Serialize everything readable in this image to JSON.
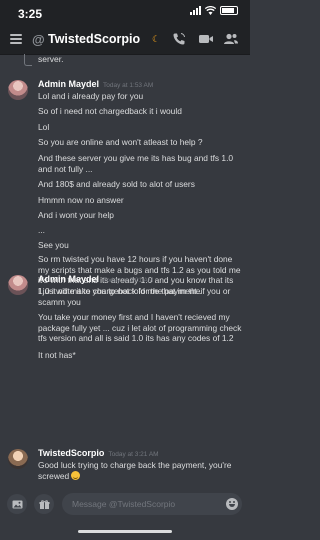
{
  "status": {
    "time": "3:25"
  },
  "header": {
    "at": "@",
    "channel": "TwistedScorpio",
    "moon": "☾"
  },
  "prev": {
    "text": "server."
  },
  "messages": [
    {
      "author": "Admin Maydel",
      "timestamp": "Today at 1:53 AM",
      "lines": [
        "Lol and i already pay for you",
        "So of i need not chargedback it i would",
        "Lol",
        "So you are online and won't atleast to help ?",
        "And these server you give me its has bug and tfs 1.0 and not fully ...",
        "And 180$ and already sold to alot of users",
        "Hmmm now no answer",
        "And i wont your help",
        "...",
        "See you",
        "So rm twisted you have 12 hours if you haven't done my scripts that make a bugs and tfs 1.2 as you told me it's with that and its already 1.0 and you know that its 1.0 i will make chargeback for the payment.."
      ]
    },
    {
      "author": "Admin Maydel",
      "timestamp": "Today at 2:01 AM",
      "lines": [
        "I just note it to you to not told me that im theif you or scamm you",
        "You take your money first and I haven't recieved my package fully yet ... cuz i let alot of programming check tfs version and all is said 1.0 its has any codes of 1.2",
        "It not has*"
      ]
    },
    {
      "author": "TwistedScorpio",
      "timestamp": "Today at 3:21 AM",
      "lines": [
        "Good luck trying to charge back the payment, you're screwed"
      ]
    }
  ],
  "composer": {
    "placeholder": "Message @TwistedScorpio"
  }
}
